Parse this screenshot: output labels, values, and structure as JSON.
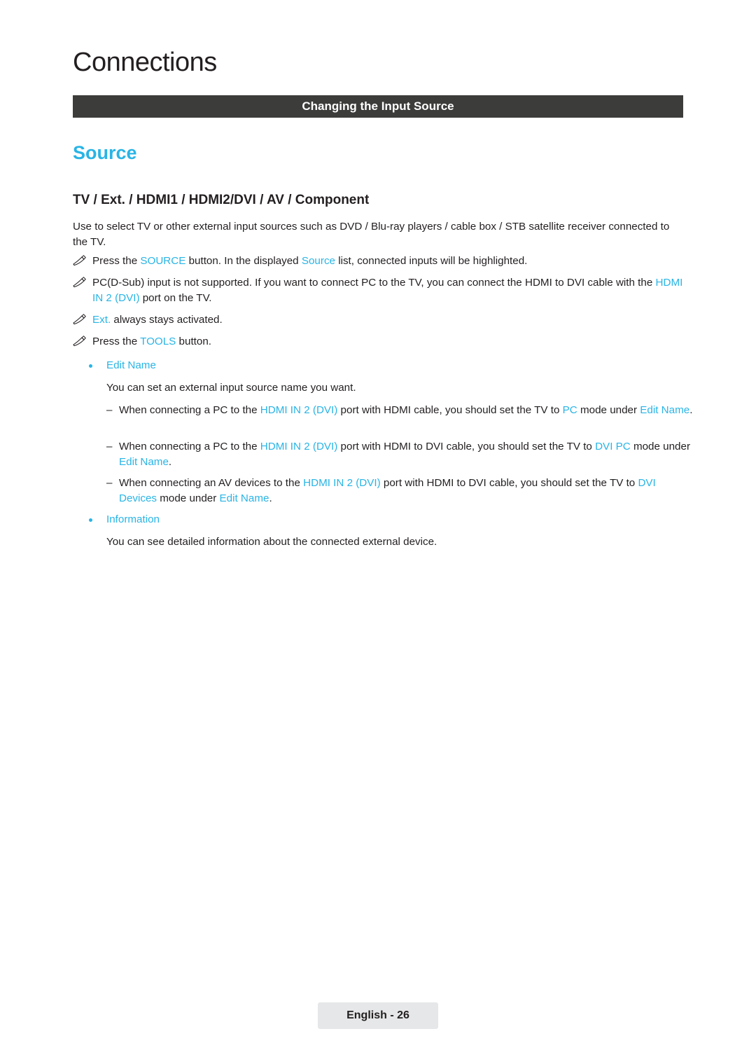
{
  "chapter": "Connections",
  "section_bar": "Changing the Input Source",
  "blue_heading": "Source",
  "sub_heading": "TV / Ext. / HDMI1 / HDMI2/DVI / AV / Component",
  "intro": "Use to select TV or other external input sources such as DVD / Blu-ray players / cable box / STB satellite receiver connected to the TV.",
  "notes": [
    {
      "icon": "pencil-note-icon",
      "segments": [
        {
          "t": "Press the ",
          "c": "dark"
        },
        {
          "t": "SOURCE",
          "c": "cyan"
        },
        {
          "t": " button. In the displayed ",
          "c": "dark"
        },
        {
          "t": "Source",
          "c": "cyan"
        },
        {
          "t": " list, connected inputs will be highlighted.",
          "c": "dark"
        }
      ]
    },
    {
      "icon": "pencil-note-icon",
      "segments": [
        {
          "t": "PC(D-Sub) input is not supported. If you want to connect PC to the TV, you can connect the HDMI to DVI cable with the ",
          "c": "dark"
        },
        {
          "t": "HDMI IN 2 (DVI)",
          "c": "cyan"
        },
        {
          "t": " port on the TV.",
          "c": "dark"
        }
      ]
    },
    {
      "icon": "pencil-note-icon",
      "segments": [
        {
          "t": "Ext.",
          "c": "cyan"
        },
        {
          "t": " always stays activated.",
          "c": "dark"
        }
      ]
    },
    {
      "icon": "pencil-note-icon",
      "segments": [
        {
          "t": "Press the ",
          "c": "dark"
        },
        {
          "t": "TOOLS",
          "c": "cyan"
        },
        {
          "t": " button.",
          "c": "dark"
        }
      ]
    }
  ],
  "bullets": [
    {
      "label": "Edit Name",
      "desc": "You can set an external input source name you want."
    },
    {
      "label": "Information",
      "desc": "You can see detailed information about the connected external device."
    }
  ],
  "dashes": [
    {
      "segments": [
        {
          "t": "When connecting a PC to the ",
          "c": "dark"
        },
        {
          "t": "HDMI IN 2 (DVI)",
          "c": "cyan"
        },
        {
          "t": " port with HDMI cable, you should set the TV to ",
          "c": "dark"
        },
        {
          "t": "PC",
          "c": "cyan"
        },
        {
          "t": " mode under ",
          "c": "dark"
        },
        {
          "t": "Edit Name",
          "c": "cyan"
        },
        {
          "t": ".",
          "c": "dark"
        }
      ]
    },
    {
      "segments": [
        {
          "t": "When connecting a PC to the ",
          "c": "dark"
        },
        {
          "t": "HDMI IN 2 (DVI)",
          "c": "cyan"
        },
        {
          "t": " port with HDMI to DVI cable, you should set the TV to ",
          "c": "dark"
        },
        {
          "t": "DVI PC",
          "c": "cyan"
        },
        {
          "t": " mode under ",
          "c": "dark"
        },
        {
          "t": "Edit Name",
          "c": "cyan"
        },
        {
          "t": ".",
          "c": "dark"
        }
      ]
    },
    {
      "segments": [
        {
          "t": "When connecting an AV devices to the ",
          "c": "dark"
        },
        {
          "t": "HDMI IN 2 (DVI)",
          "c": "cyan"
        },
        {
          "t": " port with HDMI to DVI cable, you should set the TV to ",
          "c": "dark"
        },
        {
          "t": "DVI Devices",
          "c": "cyan"
        },
        {
          "t": " mode under ",
          "c": "dark"
        },
        {
          "t": "Edit Name",
          "c": "cyan"
        },
        {
          "t": ".",
          "c": "dark"
        }
      ]
    }
  ],
  "footer": "English - 26",
  "colors": {
    "accent": "#29b4e5",
    "bar": "#3c3c3b",
    "text": "#231f20",
    "footer_bg": "#e6e7e8"
  }
}
